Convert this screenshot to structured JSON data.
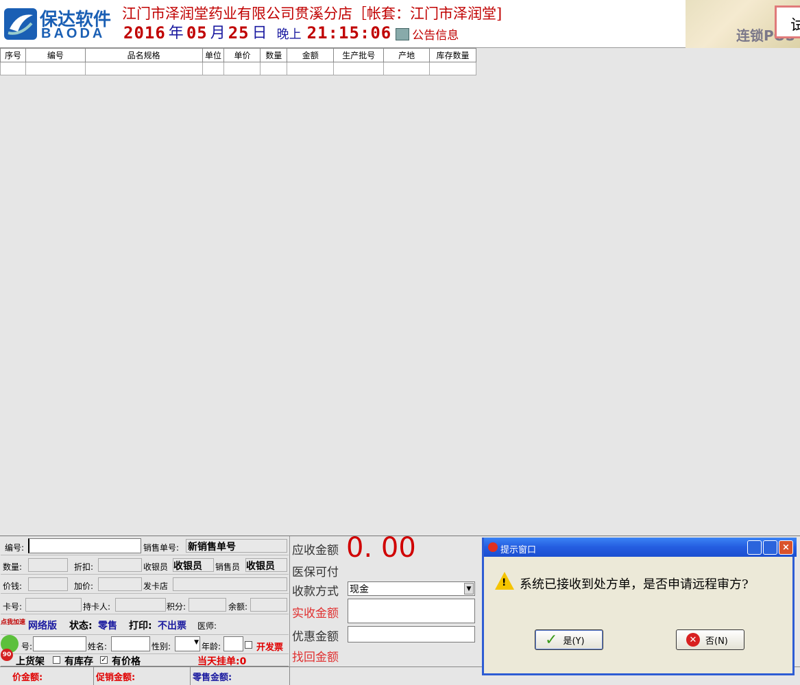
{
  "header": {
    "logo_cn": "保达软件",
    "logo_en": "BAODA",
    "company": "江门市泽润堂药业有限公司贯溪分店［帐套：江门市泽润堂]",
    "date": {
      "year": "2016",
      "year_unit": "年",
      "month": "05",
      "month_unit": "月",
      "day": "25",
      "day_unit": "日"
    },
    "ampm": "晚上",
    "time": "21:15:06",
    "notice": "公告信息",
    "banner_text": "连锁POS",
    "trial_text": "试用"
  },
  "grid": {
    "columns": [
      "序号",
      "编号",
      "品名规格",
      "单位",
      "单价",
      "数量",
      "金额",
      "生产批号",
      "产地",
      "库存数量"
    ]
  },
  "form": {
    "code_label": "编号:",
    "sales_no_label": "销售单号:",
    "sales_no_value": "新销售单号",
    "qty_label": "数量:",
    "discount_label": "折扣:",
    "cashier_label": "收银员",
    "cashier_value": "收银员",
    "seller_label": "销售员",
    "seller_value": "收银员",
    "price_label": "价钱:",
    "markup_label": "加价:",
    "card_store_label": "发卡店",
    "card_no_label": "卡号:",
    "holder_label": "持卡人:",
    "points_label": "积分:",
    "balance_label": "余额:",
    "speedup_label": "点我加速",
    "version_label": "网络版",
    "status_label": "状态:",
    "status_value": "零售",
    "print_label": "打印:",
    "print_value": "不出票",
    "doctor_label": "医师:",
    "id_label": "号:",
    "name_label": "姓名:",
    "gender_label": "性别:",
    "age_label": "年龄:",
    "invoice_label": "开发票",
    "shelf_label": "上货架",
    "stock_label": "有库存",
    "price_flag_label": "有价格",
    "hold_label": "当天挂单:0",
    "price_total_label": "价金额:",
    "promo_total_label": "促销金额:",
    "retail_total_label": "零售金额:",
    "badge_value": "90"
  },
  "pay": {
    "due_label": "应收金额",
    "due_value": "0. 00",
    "insurance_label": "医保可付",
    "method_label": "收款方式",
    "method_value": "现金",
    "paid_label": "实收金额",
    "discount_label": "优惠金额",
    "change_label": "找回金额"
  },
  "dialog": {
    "title": "提示窗口",
    "message": "系统已接收到处方单，是否申请远程审方?",
    "yes_label": "是(Y)",
    "no_label": "否(N)"
  },
  "colors": {
    "accent_red": "#c00000",
    "brand_blue": "#1a5fb4",
    "dialog_title": "#245de0"
  }
}
